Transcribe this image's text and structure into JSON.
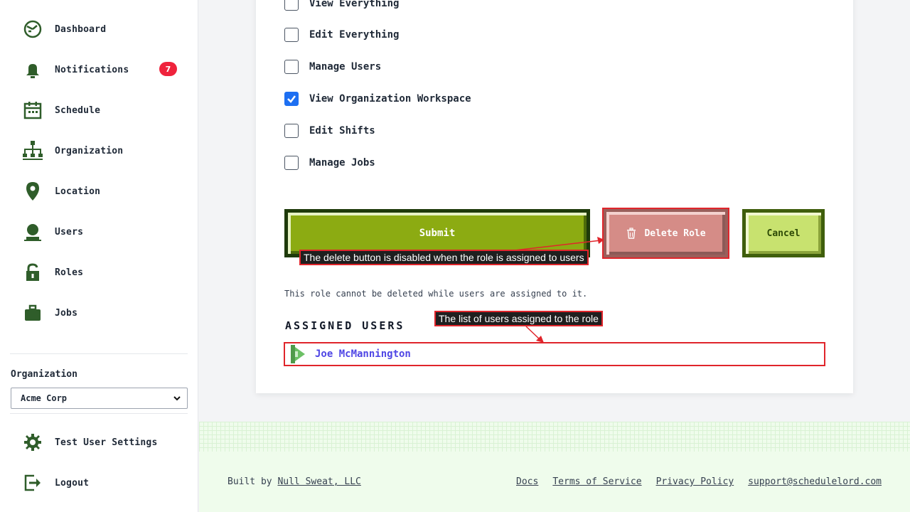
{
  "sidebar": {
    "items": [
      {
        "label": "Dashboard",
        "icon": "dashboard-icon"
      },
      {
        "label": "Notifications",
        "icon": "bell-icon",
        "badge": "7"
      },
      {
        "label": "Schedule",
        "icon": "calendar-icon"
      },
      {
        "label": "Organization",
        "icon": "org-chart-icon"
      },
      {
        "label": "Location",
        "icon": "map-pin-icon"
      },
      {
        "label": "Users",
        "icon": "user-icon"
      },
      {
        "label": "Roles",
        "icon": "lock-icon"
      },
      {
        "label": "Jobs",
        "icon": "briefcase-icon"
      }
    ],
    "organization_label": "Organization",
    "organization_value": "Acme Corp",
    "bottom_items": [
      {
        "label": "Test User Settings",
        "icon": "gear-icon"
      },
      {
        "label": "Logout",
        "icon": "logout-icon"
      }
    ]
  },
  "permissions": [
    {
      "label": "View Everything",
      "checked": false
    },
    {
      "label": "Edit Everything",
      "checked": false
    },
    {
      "label": "Manage Users",
      "checked": false
    },
    {
      "label": "View Organization Workspace",
      "checked": true
    },
    {
      "label": "Edit Shifts",
      "checked": false
    },
    {
      "label": "Manage Jobs",
      "checked": false
    }
  ],
  "buttons": {
    "submit": "Submit",
    "delete": "Delete Role",
    "cancel": "Cancel"
  },
  "note": "This role cannot be deleted while users are assigned to it.",
  "assigned_users": {
    "title": "ASSIGNED USERS",
    "users": [
      "Joe McMannington"
    ]
  },
  "annotations": {
    "delete_hint": "The delete button is disabled when the role is assigned to users",
    "list_hint": "The list of users assigned to the role"
  },
  "footer": {
    "built_by_prefix": "Built by",
    "built_by_link": "Null Sweat, LLC",
    "links": [
      "Docs",
      "Terms of Service",
      "Privacy Policy",
      "support@schedulelord.com"
    ]
  },
  "colors": {
    "sidebar_icon": "#2f5d2a",
    "submit": "#8cab12",
    "delete_disabled": "#d58c87",
    "cancel": "#c8e26f",
    "checkbox_checked": "#1d6ff2",
    "annotation_border": "#e0252b",
    "user_link": "#4f46e5",
    "badge": "#ef233c"
  }
}
